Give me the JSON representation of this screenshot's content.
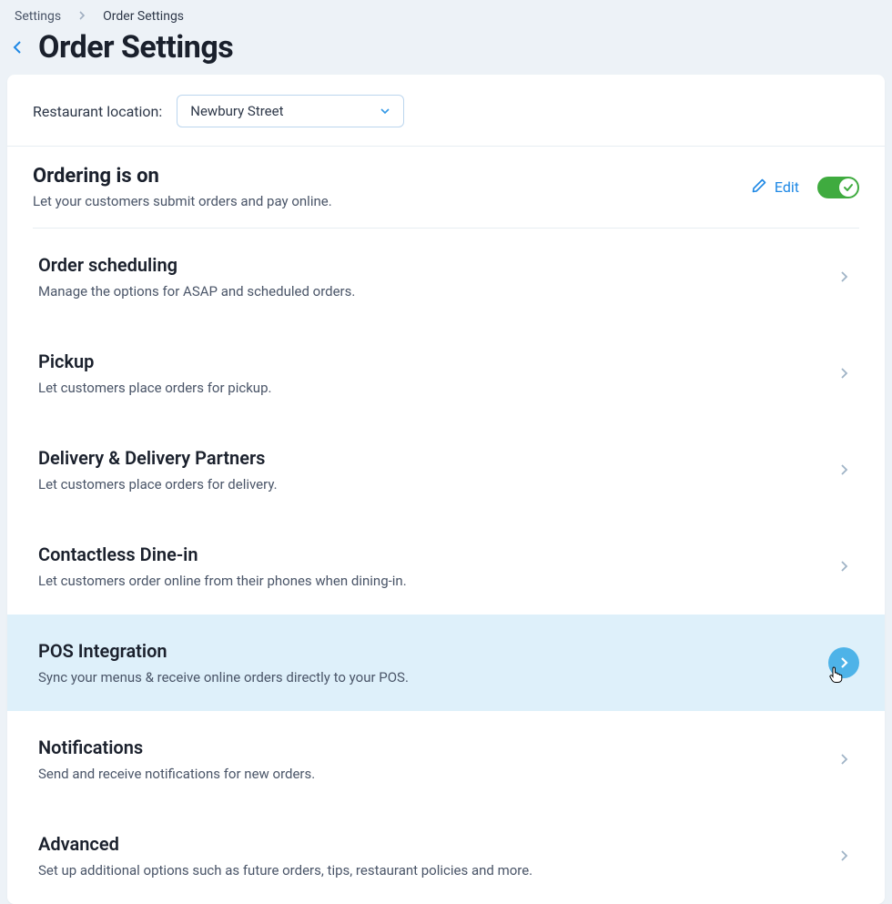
{
  "breadcrumb": {
    "root": "Settings",
    "current": "Order Settings"
  },
  "page": {
    "title": "Order Settings"
  },
  "location": {
    "label": "Restaurant location:",
    "selected": "Newbury Street"
  },
  "ordering": {
    "title": "Ordering is on",
    "subtitle": "Let your customers submit orders and pay online.",
    "edit_label": "Edit",
    "toggle_on": true
  },
  "rows": [
    {
      "title": "Order scheduling",
      "subtitle": "Manage the options for ASAP and scheduled orders."
    },
    {
      "title": "Pickup",
      "subtitle": "Let customers place orders for pickup."
    },
    {
      "title": "Delivery & Delivery Partners",
      "subtitle": "Let customers place orders for delivery."
    },
    {
      "title": "Contactless Dine-in",
      "subtitle": "Let customers order online from their phones when dining-in."
    },
    {
      "title": "POS Integration",
      "subtitle": "Sync your menus & receive online orders directly to your POS."
    },
    {
      "title": "Notifications",
      "subtitle": "Send and receive notifications for new orders."
    },
    {
      "title": "Advanced",
      "subtitle": "Set up additional options such as future orders, tips, restaurant policies and more."
    }
  ]
}
